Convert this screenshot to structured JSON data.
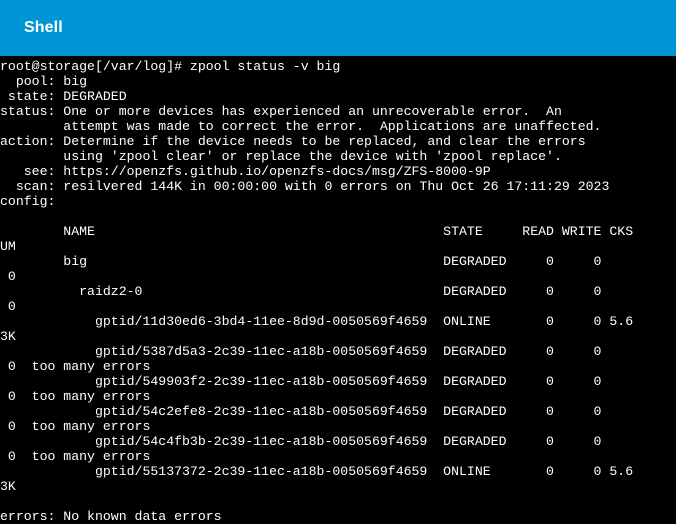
{
  "header": {
    "title": "Shell"
  },
  "terminal": {
    "lines": [
      "root@storage[/var/log]# zpool status -v big",
      "  pool: big",
      " state: DEGRADED",
      "status: One or more devices has experienced an unrecoverable error.  An",
      "        attempt was made to correct the error.  Applications are unaffected.",
      "action: Determine if the device needs to be replaced, and clear the errors",
      "        using 'zpool clear' or replace the device with 'zpool replace'.",
      "   see: https://openzfs.github.io/openzfs-docs/msg/ZFS-8000-9P",
      "  scan: resilvered 144K in 00:00:00 with 0 errors on Thu Oct 26 17:11:29 2023",
      "config:",
      "",
      "        NAME                                            STATE     READ WRITE CKS",
      "UM",
      "        big                                             DEGRADED     0     0",
      " 0",
      "          raidz2-0                                      DEGRADED     0     0",
      " 0",
      "            gptid/11d30ed6-3bd4-11ee-8d9d-0050569f4659  ONLINE       0     0 5.6",
      "3K",
      "            gptid/5387d5a3-2c39-11ec-a18b-0050569f4659  DEGRADED     0     0",
      " 0  too many errors",
      "            gptid/549903f2-2c39-11ec-a18b-0050569f4659  DEGRADED     0     0",
      " 0  too many errors",
      "            gptid/54c2efe8-2c39-11ec-a18b-0050569f4659  DEGRADED     0     0",
      " 0  too many errors",
      "            gptid/54c4fb3b-2c39-11ec-a18b-0050569f4659  DEGRADED     0     0",
      " 0  too many errors",
      "            gptid/55137372-2c39-11ec-a18b-0050569f4659  ONLINE       0     0 5.6",
      "3K",
      "",
      "errors: No known data errors"
    ]
  },
  "colors": {
    "header_bg": "#0095d5",
    "terminal_bg": "#000000",
    "terminal_fg": "#ffffff"
  }
}
